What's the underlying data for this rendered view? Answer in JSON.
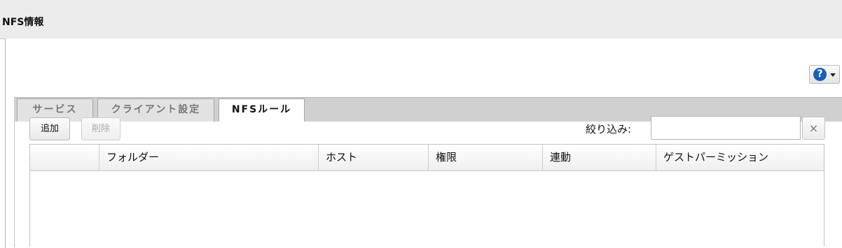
{
  "panel": {
    "title": "NFS情報"
  },
  "help": {
    "icon": "help-icon",
    "symbol": "?"
  },
  "tabs": [
    {
      "label": "サービス",
      "active": false
    },
    {
      "label": "クライアント設定",
      "active": false
    },
    {
      "label": "NFSルール",
      "active": true
    }
  ],
  "toolbar": {
    "add_label": "追加",
    "delete_label": "削除",
    "filter_label": "絞り込み:",
    "filter_value": "",
    "filter_placeholder": "",
    "clear_symbol": "×"
  },
  "grid": {
    "columns": [
      "",
      "フォルダー",
      "ホスト",
      "権限",
      "連動",
      "ゲストパーミッション"
    ],
    "rows": []
  }
}
